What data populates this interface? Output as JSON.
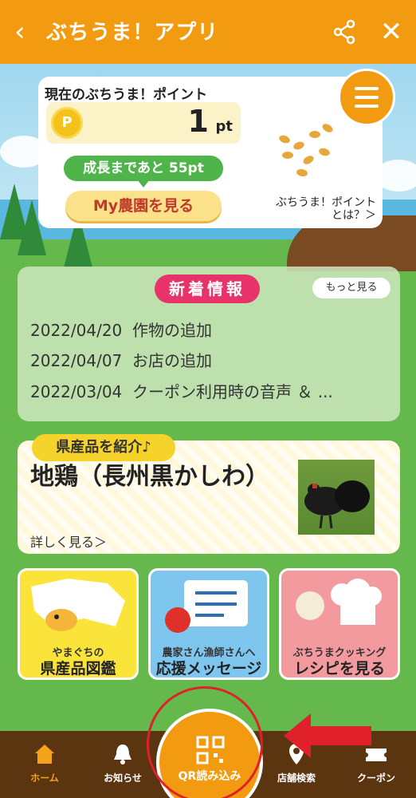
{
  "header": {
    "back_icon": "chevron-left-icon",
    "title": "ぶちうま！アプリ",
    "share_icon": "share-icon",
    "close_icon": "close-icon"
  },
  "points": {
    "title": "現在のぶちうま！ポイント",
    "coin_label": "P",
    "value": "1",
    "unit": "pt",
    "growth_text": "成長まであと 55pt",
    "farm_button": "My農園を見る",
    "help_line1": "ぶちうま！ポイント",
    "help_line2": "とは？＞"
  },
  "menu_icon": "hamburger-menu-icon",
  "news": {
    "tag": "新着情報",
    "more": "もっと見る",
    "items": [
      {
        "date": "2022/04/20",
        "text": "作物の追加"
      },
      {
        "date": "2022/04/07",
        "text": "お店の追加"
      },
      {
        "date": "2022/03/04",
        "text": "クーポン利用時の音声 ＆ ..."
      }
    ]
  },
  "product": {
    "tag": "県産品を紹介♪",
    "name": "地鶏（長州黒かしわ）",
    "link": "詳しく見る＞"
  },
  "tiles": [
    {
      "sub": "やまぐちの",
      "main": "県産品図鑑"
    },
    {
      "sub": "農家さん漁師さんへ",
      "main": "応援メッセージ"
    },
    {
      "sub": "ぶちうまクッキング",
      "main": "レシピを見る"
    }
  ],
  "nav": {
    "home": "ホーム",
    "notice": "お知らせ",
    "qr": "QR読み込み",
    "shop": "店舗検索",
    "coupon": "クーポン"
  },
  "colors": {
    "header": "#f29a10",
    "nav_bg": "#5b3410",
    "news_tag": "#e8336a",
    "annotation": "#e0202a"
  }
}
